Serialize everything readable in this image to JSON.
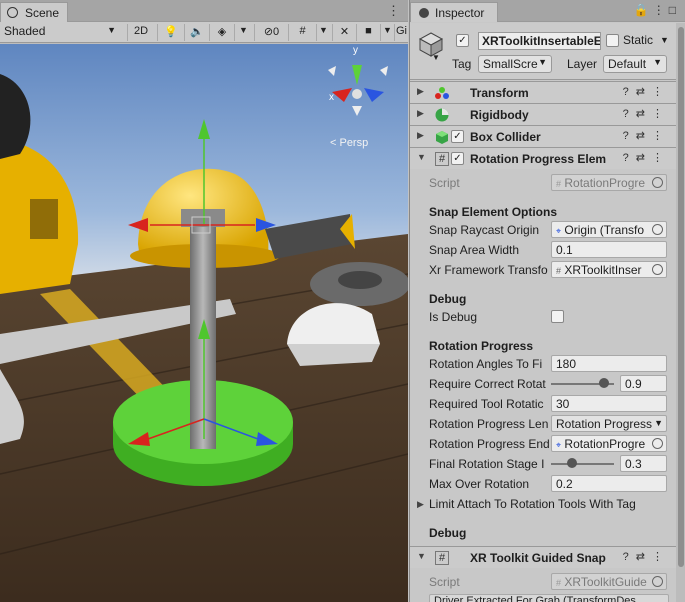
{
  "scene": {
    "tab_label": "Scene",
    "shading_mode": "Shaded",
    "mode_2d": "2D",
    "gizmos_label": "Gi",
    "persp_label": "< Persp",
    "axis_labels": {
      "x": "x",
      "y": "y"
    }
  },
  "inspector": {
    "tab_label": "Inspector",
    "object_name": "XRToolkitInsertableE",
    "static_label": "Static",
    "tag_label": "Tag",
    "tag_value": "SmallScre",
    "layer_label": "Layer",
    "layer_value": "Default",
    "components": {
      "transform": "Transform",
      "rigidbody": "Rigidbody",
      "box_collider": "Box Collider",
      "rotation_progress": "Rotation Progress Elem",
      "guided_snap": "XR Toolkit Guided Snap"
    },
    "script_label": "Script",
    "script_value": "RotationProgre",
    "snap_section": "Snap Element Options",
    "snap_raycast_label": "Snap Raycast Origin",
    "snap_raycast_value": "Origin (Transfo",
    "snap_area_label": "Snap Area Width",
    "snap_area_value": "0.1",
    "xr_framework_label": "Xr Framework Transfo",
    "xr_framework_value": "XRToolkitInser",
    "debug_section": "Debug",
    "is_debug_label": "Is Debug",
    "rotation_section": "Rotation Progress",
    "rotation_angles_label": "Rotation Angles To Fi",
    "rotation_angles_value": "180",
    "require_correct_label": "Require Correct Rotat",
    "require_correct_value": "0.9",
    "required_tool_label": "Required Tool Rotatic",
    "required_tool_value": "30",
    "progress_len_label": "Rotation Progress Len",
    "progress_len_value": "Rotation Progress",
    "progress_end_label": "Rotation Progress End",
    "progress_end_value": "RotationProgre",
    "final_stage_label": "Final Rotation Stage I",
    "final_stage_value": "0.3",
    "max_over_label": "Max Over Rotation",
    "max_over_value": "0.2",
    "limit_attach_label": "Limit Attach To Rotation Tools With Tag",
    "debug2_section": "Debug",
    "guided_script_label": "Script",
    "guided_script_value": "XRToolkitGuide",
    "driver_text": "Driver Extracted For Grab (TransformDes"
  },
  "sliders": {
    "require_correct": 0.9,
    "final_stage": 0.3
  },
  "colors": {
    "gizmo_green": "#4fc62d",
    "x_axis": "#d8241e",
    "z_axis": "#2a55e0",
    "y_axis": "#5ed23a"
  }
}
